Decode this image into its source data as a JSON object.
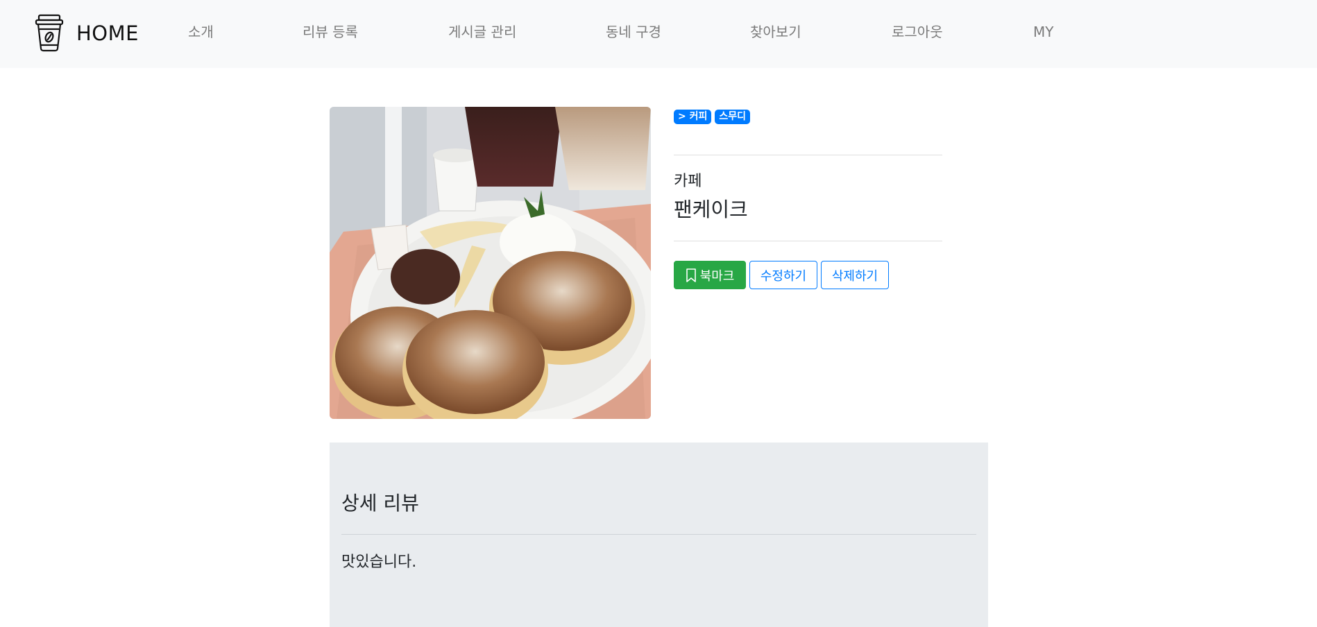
{
  "navbar": {
    "brand_icon": "coffee-cup-icon",
    "brand_text": "HOME",
    "items": [
      {
        "label": "소개"
      },
      {
        "label": "리뷰 등록"
      },
      {
        "label": "게시글 관리"
      },
      {
        "label": "동네 구경"
      },
      {
        "label": "찾아보기"
      },
      {
        "label": "로그아웃"
      },
      {
        "label": "MY"
      }
    ]
  },
  "post": {
    "image": "pancakes-photo",
    "tags": [
      "> 커피",
      "스무디"
    ],
    "category": "카페",
    "title": "팬케이크",
    "buttons": {
      "bookmark_icon": "bookmark-icon",
      "bookmark": "북마크",
      "edit": "수정하기",
      "delete": "삭제하기"
    }
  },
  "review": {
    "heading": "상세 리뷰",
    "text": "맛있습니다."
  },
  "colors": {
    "navbar_bg": "#f8f9fa",
    "tag_primary": "#007bff",
    "bookmark_button": "#28a745",
    "outline_button": "#007bff",
    "review_bg": "#e9ecef"
  }
}
